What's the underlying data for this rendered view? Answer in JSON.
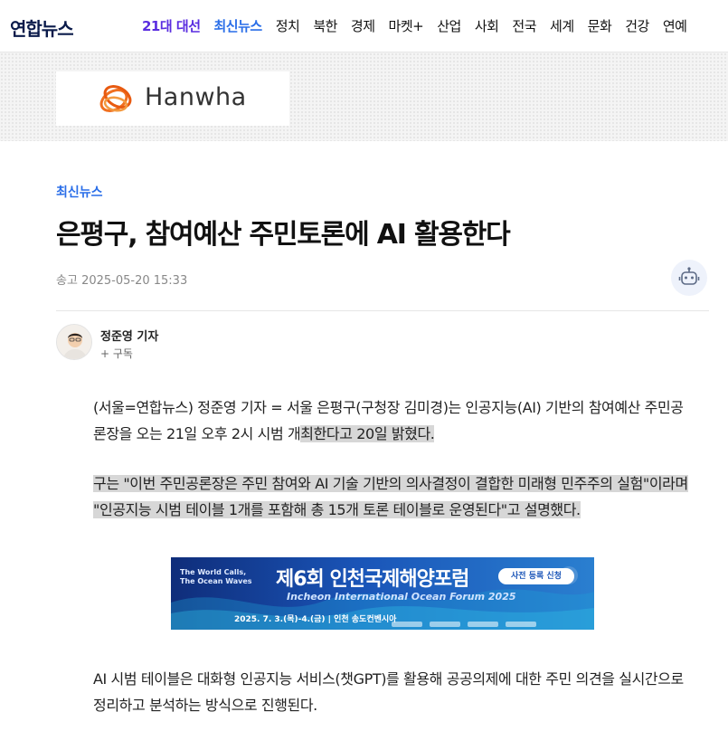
{
  "site": {
    "logo": "연합뉴스",
    "nav": [
      {
        "label": "21대 대선",
        "style": "election"
      },
      {
        "label": "최신뉴스",
        "style": "latest"
      },
      {
        "label": "정치"
      },
      {
        "label": "북한"
      },
      {
        "label": "경제"
      },
      {
        "label": "마켓+"
      },
      {
        "label": "산업"
      },
      {
        "label": "사회"
      },
      {
        "label": "전국"
      },
      {
        "label": "세계"
      },
      {
        "label": "문화"
      },
      {
        "label": "건강"
      },
      {
        "label": "연예"
      }
    ],
    "colors": {
      "election": "#5a2de0",
      "latest": "#2a6ee8",
      "logo": "#0a1a4a"
    }
  },
  "top_ad": {
    "brand": "Hanwha",
    "logo_icon": "hanwha-flame-icon"
  },
  "article": {
    "category": "최신뉴스",
    "headline": "은평구, 참여예산 주민토론에 AI 활용한다",
    "date_label": "송고",
    "date": "2025-05-20 15:33",
    "robot_icon": "robot-icon",
    "reporter": "정준영 기자",
    "subscribe": "+ 구독",
    "paragraphs": [
      {
        "plain": "(서울=연합뉴스) 정준영 기자 = 서울 은평구(구청장 김미경)는 인공지능(AI) 기반의 참여예산 주민공론장을 오는 21일 오후 2시 시범 개",
        "highlight": "최한다고 20일 밝혔다."
      },
      {
        "highlight": "구는 \"이번 주민공론장은 주민 참여와 AI 기술 기반의 의사결정이 결합한 미래형 민주주의 실험\"이라며 \"인공지능 시범 테이블 1개를 포함해 총 15개 토론 테이블로 운영된다\"고 설명했다."
      },
      {
        "plain": "AI 시범 테이블은 대화형 인공지능 서비스(챗GPT)를 활용해 공공의제에 대한 주민 의견을 실시간으로 정리하고 분석하는 방식으로 진행된다."
      }
    ]
  },
  "banner_ad": {
    "slogan": "The World Calls, The Ocean Waves",
    "title": "제6회 인천국제해양포럼",
    "subtitle": "Incheon International Ocean Forum 2025",
    "cta": "사전 등록 신청",
    "date": "2025. 7. 3.(목)-4.(금) | 인천 송도컨벤시아"
  }
}
